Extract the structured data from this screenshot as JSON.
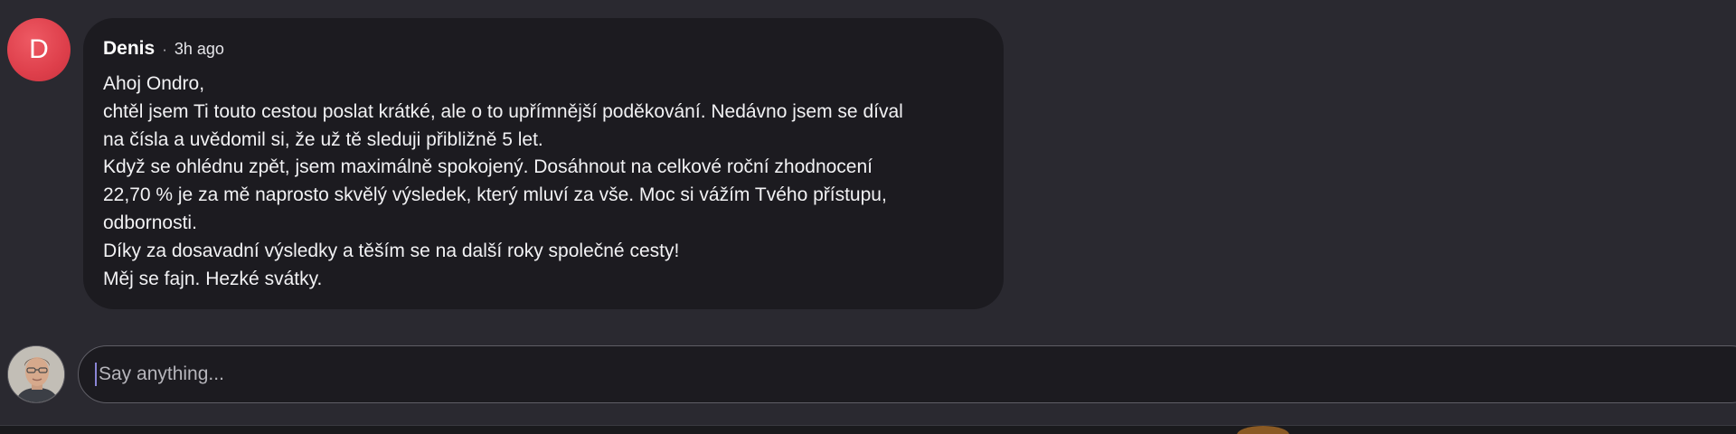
{
  "comment": {
    "avatar_letter": "D",
    "author": "Denis",
    "separator": "·",
    "time": "3h ago",
    "lines": [
      "Ahoj Ondro,",
      "chtěl jsem Ti touto cestou poslat krátké, ale o to upřímnější poděkování. Nedávno jsem se díval",
      "na čísla a uvědomil si, že už tě sleduji přibližně 5 let.",
      "Když se ohlédnu zpět, jsem maximálně spokojený. Dosáhnout na celkové roční zhodnocení",
      "22,70 % je za mě naprosto skvělý výsledek, který mluví za vše. Moc si vážím Tvého přístupu,",
      "odbornosti.",
      "Díky za dosavadní výsledky a těším se na další roky společné cesty!",
      "Měj se fajn. Hezké svátky."
    ]
  },
  "composer": {
    "placeholder": "Say anything...",
    "value": ""
  },
  "colors": {
    "background": "#2a2930",
    "bubble": "#1c1b20",
    "avatar_red": "#de3f4b",
    "caret": "#8b85d6"
  },
  "icons": {
    "user_avatar": "user-photo-avatar"
  }
}
